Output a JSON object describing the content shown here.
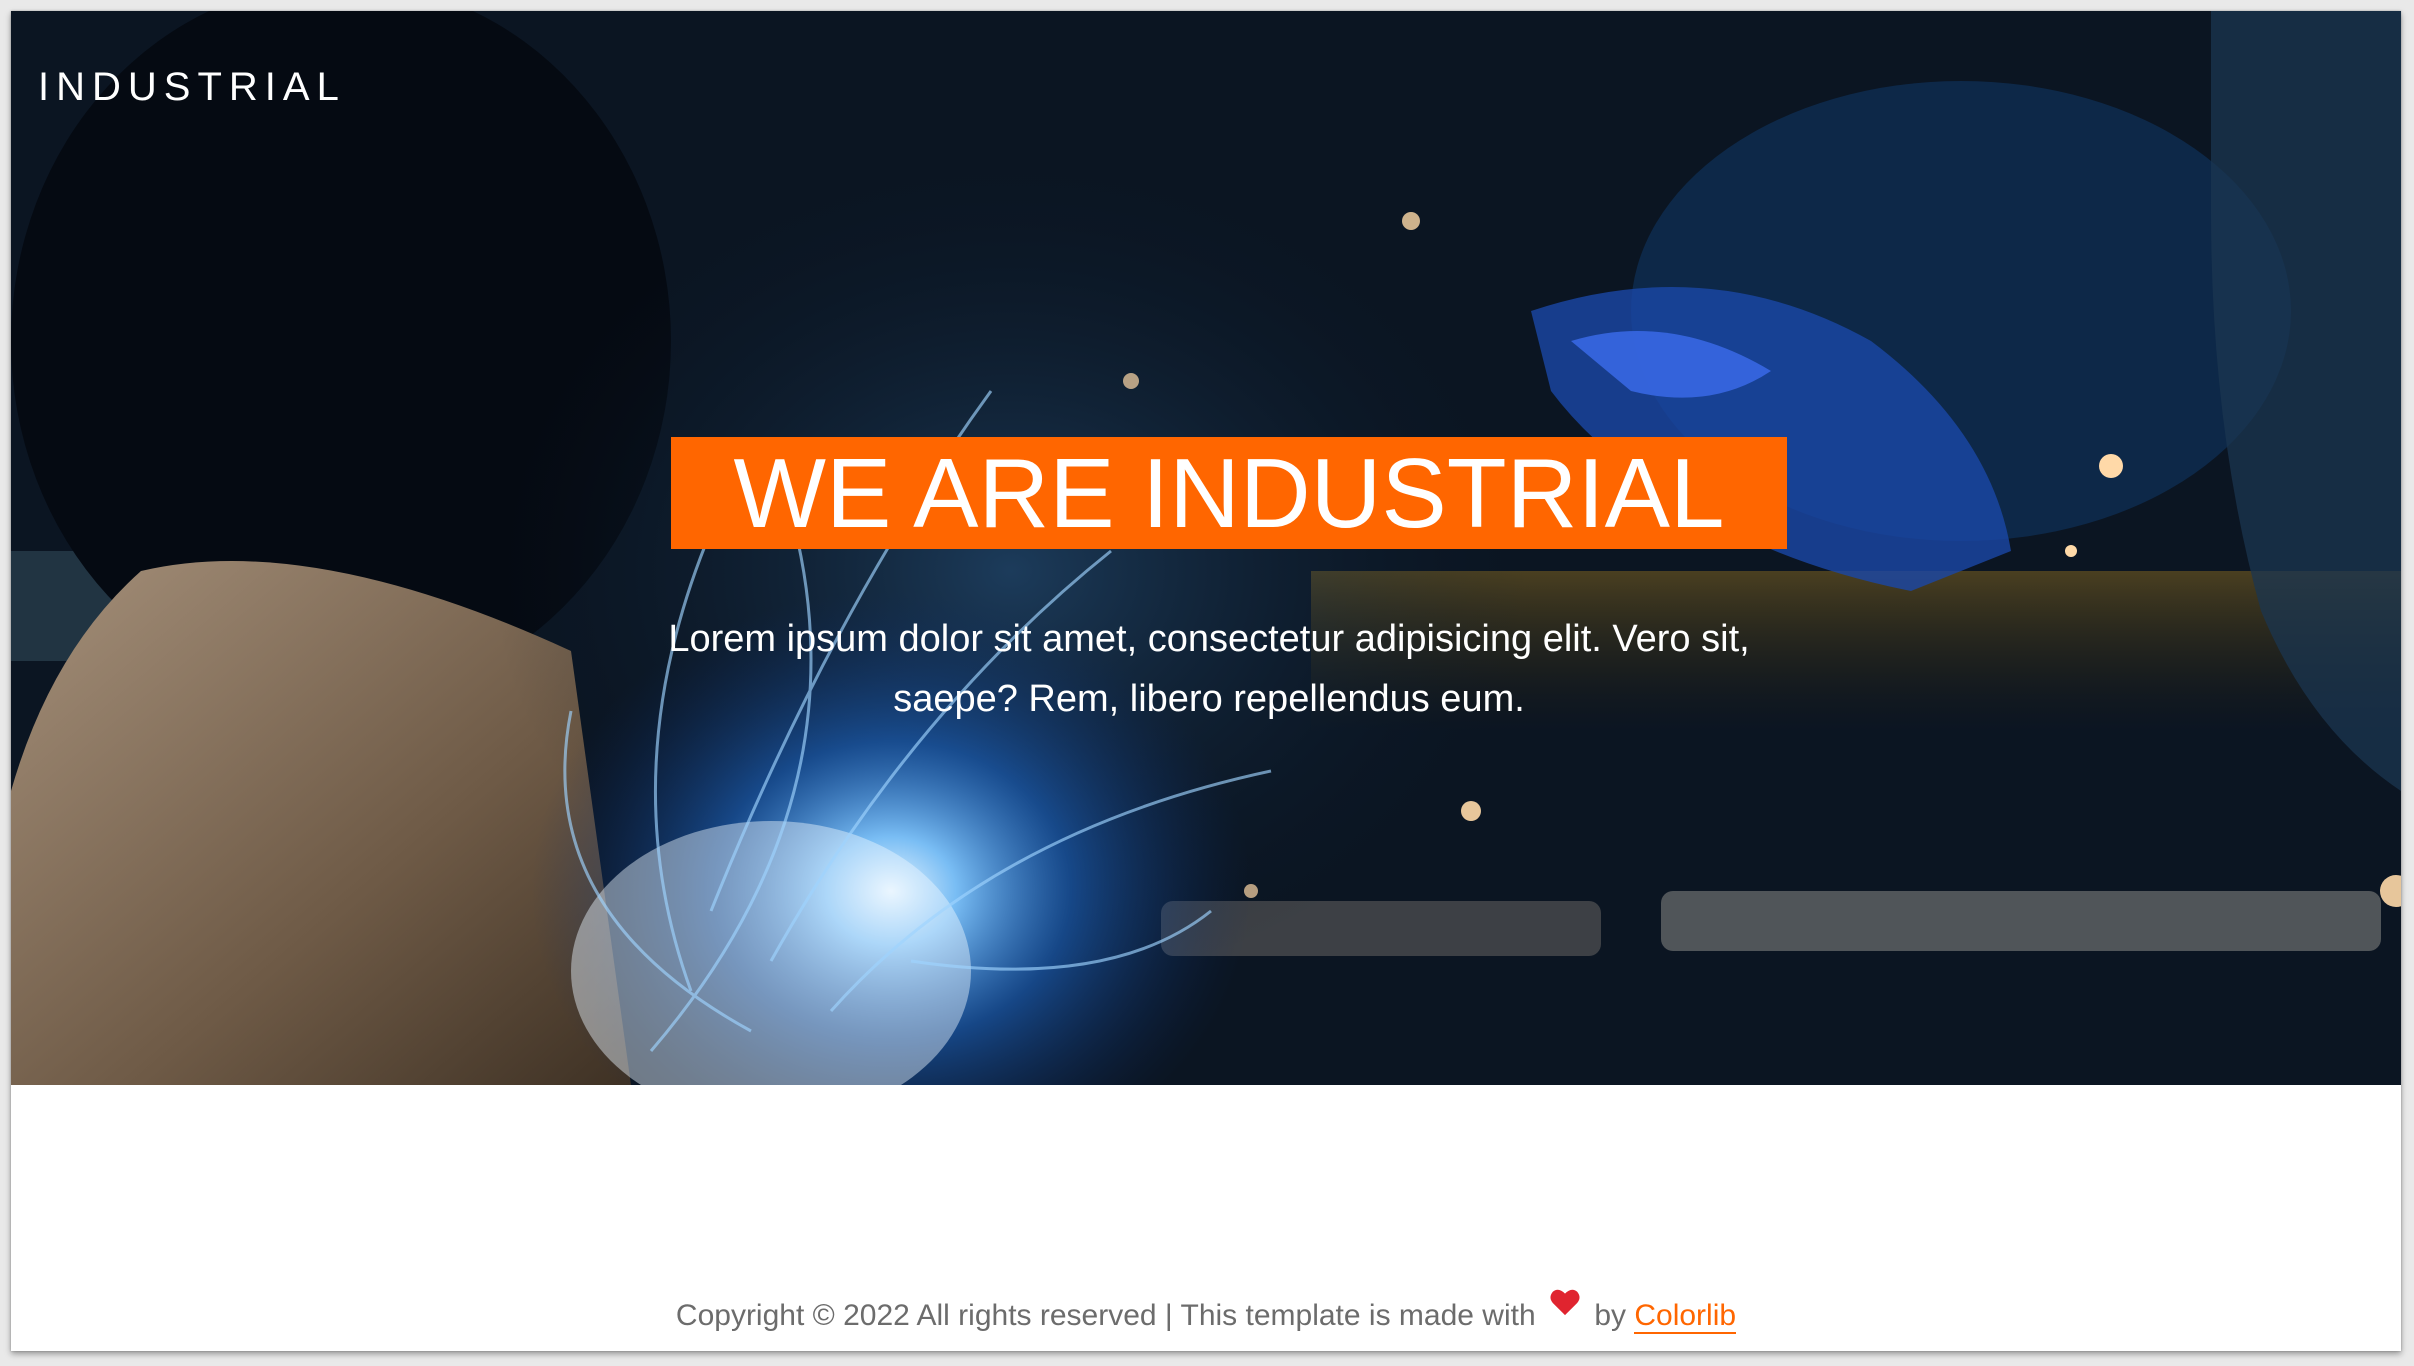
{
  "header": {
    "brand": "INDUSTRIAL"
  },
  "hero": {
    "headline": "WE ARE INDUSTRIAL",
    "lead": "Lorem ipsum dolor sit amet, consectetur adipisicing elit. Vero sit, saepe? Rem, libero repellendus eum.",
    "image_icon": "welding-photo"
  },
  "footer": {
    "text_before": "Copyright © 2022 All rights reserved | This template is made with",
    "heart_icon": "heart-icon",
    "text_by": "by",
    "link_label": "Colorlib"
  },
  "colors": {
    "accent": "#ff6600",
    "heart": "#e0242f",
    "footer_text": "#6c6c6c"
  }
}
